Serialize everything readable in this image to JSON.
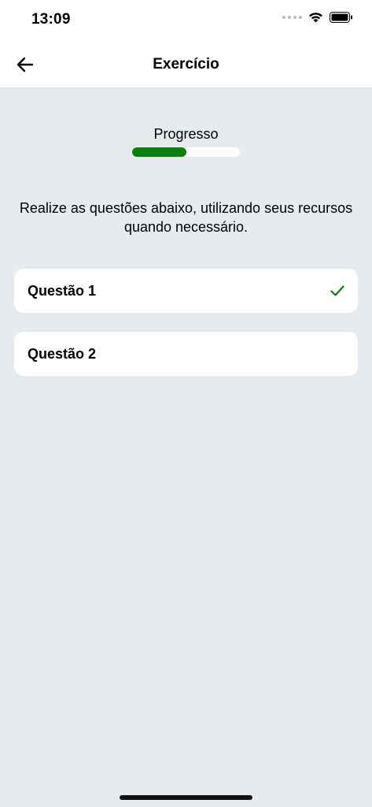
{
  "status_bar": {
    "time": "13:09"
  },
  "nav": {
    "title": "Exercício",
    "back_icon": "arrow-left-icon"
  },
  "progress": {
    "label": "Progresso",
    "value": 0.5,
    "fill_color": "#0a7f10"
  },
  "instructions": "Realize as questões abaixo, utilizando seus recursos quando necessário.",
  "questions": [
    {
      "label": "Questão 1",
      "completed": true,
      "icon": "check-icon"
    },
    {
      "label": "Questão 2",
      "completed": false
    }
  ],
  "colors": {
    "background": "#e8ebee",
    "card": "#ffffff",
    "accent": "#0a7f10"
  }
}
